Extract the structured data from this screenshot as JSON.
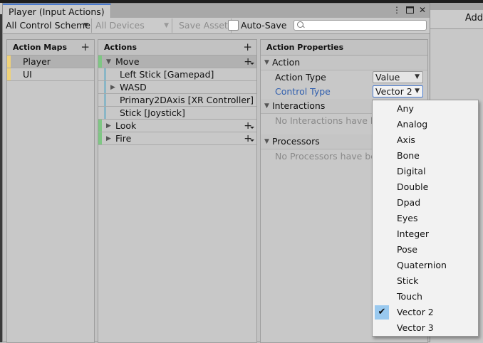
{
  "window": {
    "title": "Player (Input Actions)",
    "background_right_button": "Add"
  },
  "toolbar": {
    "control_scheme": "All Control Scheme",
    "devices": "All Devices",
    "save_asset": "Save Asset",
    "auto_save": "Auto-Save",
    "auto_save_checked": false,
    "search_value": ""
  },
  "action_maps": {
    "header": "Action Maps",
    "items": [
      {
        "label": "Player",
        "selected": true
      },
      {
        "label": "UI",
        "selected": false
      }
    ]
  },
  "actions": {
    "header": "Actions",
    "rows": [
      {
        "type": "action",
        "label": "Move",
        "expanded": true,
        "selected": true
      },
      {
        "type": "binding",
        "label": "Left Stick [Gamepad]"
      },
      {
        "type": "composite",
        "label": "WASD",
        "expanded": false
      },
      {
        "type": "binding",
        "label": "Primary2DAxis [XR Controller]"
      },
      {
        "type": "binding",
        "label": "Stick [Joystick]"
      },
      {
        "type": "action",
        "label": "Look",
        "expanded": false
      },
      {
        "type": "action",
        "label": "Fire",
        "expanded": false
      }
    ]
  },
  "properties": {
    "header": "Action Properties",
    "action_section": "Action",
    "action_type_label": "Action Type",
    "action_type_value": "Value",
    "control_type_label": "Control Type",
    "control_type_value": "Vector 2",
    "interactions_section": "Interactions",
    "interactions_empty": "No Interactions have bee",
    "processors_section": "Processors",
    "processors_empty": "No Processors have bee"
  },
  "control_type_menu": {
    "items": [
      "Any",
      "Analog",
      "Axis",
      "Bone",
      "Digital",
      "Double",
      "Dpad",
      "Eyes",
      "Integer",
      "Pose",
      "Quaternion",
      "Stick",
      "Touch",
      "Vector 2",
      "Vector 3"
    ],
    "selected": "Vector 2"
  },
  "colors": {
    "action_map_marker": "#f0d278",
    "action_marker": "#7fc784",
    "binding_marker": "#8ab6c6",
    "focus": "#4a7bd0",
    "menu_selected": "#99c9ef"
  }
}
